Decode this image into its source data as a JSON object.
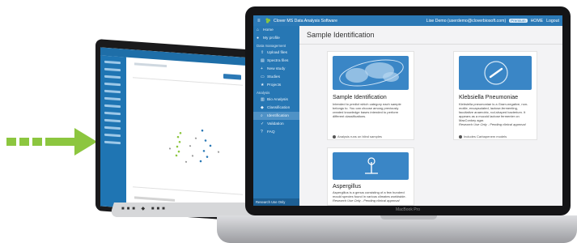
{
  "app": {
    "title": "Clover MS Data Analysis Software",
    "user": "Lise Demo (userdemo@cloverbiosoft.com)",
    "badge": "Premium",
    "home": "HOME",
    "logout": "Logout"
  },
  "sidebar": {
    "items": [
      {
        "label": "Home",
        "icon": "home-icon"
      },
      {
        "label": "My profile",
        "icon": "user-icon"
      }
    ],
    "section1": "Data management",
    "data_items": [
      {
        "label": "Upload files",
        "icon": "upload-icon"
      },
      {
        "label": "Spectra files",
        "icon": "file-icon"
      },
      {
        "label": "New study",
        "icon": "plus-icon"
      },
      {
        "label": "Studies",
        "icon": "folder-icon"
      },
      {
        "label": "Projects",
        "icon": "star-icon"
      }
    ],
    "section2": "Analysis",
    "analysis_items": [
      {
        "label": "Bio Analysis",
        "icon": "chart-icon"
      },
      {
        "label": "Classification",
        "icon": "tag-icon"
      },
      {
        "label": "Identification",
        "icon": "search-icon",
        "active": true
      },
      {
        "label": "Validation",
        "icon": "check-icon"
      },
      {
        "label": "FAQ",
        "icon": "question-icon"
      }
    ],
    "footer": "Research Use Only"
  },
  "page": {
    "title": "Sample Identification"
  },
  "cards": [
    {
      "title": "Sample Identification",
      "text": "Intended to predict which category each sample belongs to. You can choose among previously created knowledge bases intended to perform different classifications.",
      "footer": "Analysis runs on blind samples"
    },
    {
      "title": "Klebsiella Pneumoniae",
      "text": "Klebsiella pneumoniae is a Gram-negative, non-motile, encapsulated, lactose-fermenting, facultative anaerobic, rod-shaped bacterium. It appears as a mucoid lactose fermenter on MacConkey agar.",
      "note": "Research Use Only - Pending clinical approval",
      "footer": "Includes Carbapenem models"
    },
    {
      "title": "Aspergillus",
      "text": "Aspergillus is a genus consisting of a few hundred mould species found in various climates worldwide.",
      "note": "Research Use Only - Pending clinical approval"
    }
  ],
  "laptop_label": "MacBook Pro",
  "colors": {
    "arrow": "#8cc63f",
    "accent": "#2b79b6",
    "sidebar": "#2777b4"
  }
}
